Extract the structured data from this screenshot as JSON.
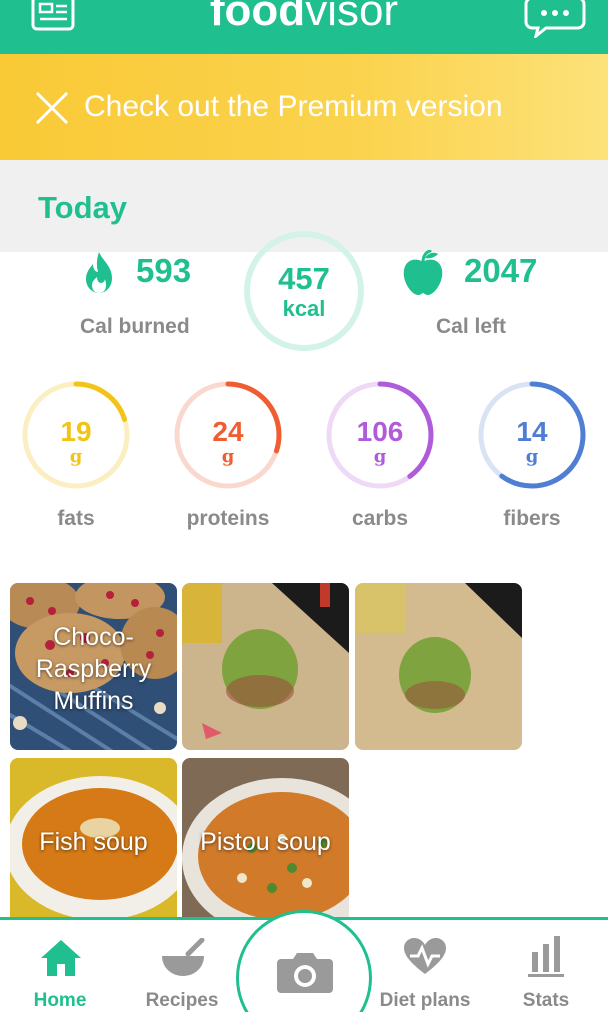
{
  "header": {
    "brand_bold": "food",
    "brand_light": "visor",
    "color": "#1fbf8f"
  },
  "premium": {
    "text": "Check out the Premium version",
    "close_icon": "close-icon"
  },
  "today": {
    "label": "Today"
  },
  "calories": {
    "burned_value": "593",
    "burned_label": "Cal burned",
    "consumed_value": "457",
    "consumed_unit": "kcal",
    "left_value": "2047",
    "left_label": "Cal left"
  },
  "macros": [
    {
      "label": "fats",
      "value": "19",
      "unit": "g",
      "color": "#f2c318",
      "track": "#fbefc2",
      "progress": 0.2
    },
    {
      "label": "proteins",
      "value": "24",
      "unit": "g",
      "color": "#ef5e32",
      "track": "#fbd8cd",
      "progress": 0.3
    },
    {
      "label": "carbs",
      "value": "106",
      "unit": "g",
      "color": "#b05bd9",
      "track": "#eedaf7",
      "progress": 0.4
    },
    {
      "label": "fibers",
      "value": "14",
      "unit": "g",
      "color": "#4f7ed4",
      "track": "#d9e3f6",
      "progress": 0.6
    }
  ],
  "meals": [
    {
      "label": "Choco-\nRaspberry\nMuffins"
    },
    {
      "label": ""
    },
    {
      "label": ""
    },
    {
      "label": "Fish soup"
    },
    {
      "label": "Pistou soup"
    }
  ],
  "nav": {
    "home": "Home",
    "recipes": "Recipes",
    "diet_plans": "Diet plans",
    "stats": "Stats",
    "active_color": "#1fbf8f"
  }
}
